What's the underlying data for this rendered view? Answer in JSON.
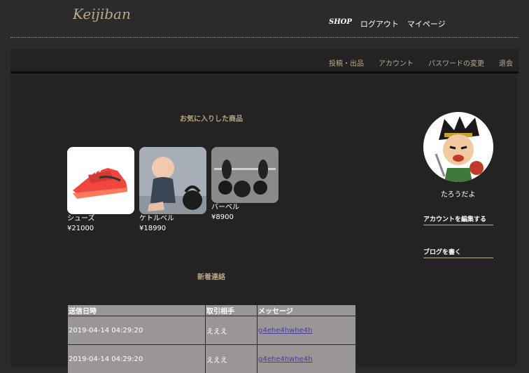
{
  "header": {
    "logo": "Keijiban",
    "nav": [
      "SHOP",
      "ログアウト",
      "マイページ"
    ]
  },
  "subnav": [
    "投稿・出品",
    "アカウント",
    "パスワードの変更",
    "退会"
  ],
  "favorites": {
    "title": "お気に入りした商品",
    "items": [
      {
        "name": "シューズ",
        "price": "¥21000",
        "image": "red-sneaker"
      },
      {
        "name": "ケトルベル",
        "price": "¥18990",
        "image": "baby-with-kettlebell"
      },
      {
        "name": "バーベル",
        "price": "¥8900",
        "image": "barbell-plates"
      }
    ]
  },
  "messages": {
    "title": "新着連絡",
    "headers": [
      "送信日時",
      "取引相手",
      "メッセージ"
    ],
    "rows": [
      {
        "date": "2019-04-14 04:29:20",
        "partner": "えええ",
        "message": "g4ehe4hwhe4h"
      },
      {
        "date": "2019-04-14 04:29:20",
        "partner": "えええ",
        "message": "g4ehe4hwhe4h"
      }
    ]
  },
  "profile": {
    "username": "たろうだよ",
    "avatar": "samurai-cartoon-avatar",
    "links": [
      "アカウントを編集する",
      "ブログを書く"
    ]
  },
  "colors": {
    "background": "#2a2a2a",
    "panel": "#232323",
    "accent": "#b8ab8f",
    "table_bg": "#9b9696",
    "link": "#4a3aa0"
  }
}
